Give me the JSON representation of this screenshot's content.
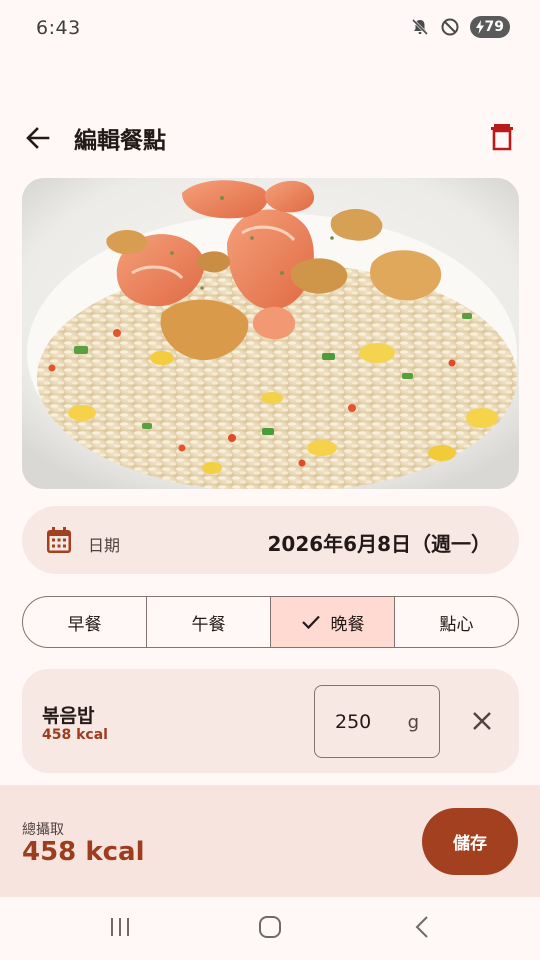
{
  "status_bar": {
    "time": "6:43",
    "battery_level": "79",
    "icons": [
      "mute-icon",
      "do-not-disturb-icon",
      "battery-icon"
    ]
  },
  "app_bar": {
    "title": "編輯餐點",
    "back_icon": "arrow-left-icon",
    "delete_icon": "trash-icon"
  },
  "photo": {
    "subject": "shrimp fried rice"
  },
  "date_field": {
    "label": "日期",
    "value": "2026年6月8日（週一）",
    "icon": "calendar-icon"
  },
  "meal_types": [
    {
      "label": "早餐",
      "selected": false
    },
    {
      "label": "午餐",
      "selected": false
    },
    {
      "label": "晚餐",
      "selected": true
    },
    {
      "label": "點心",
      "selected": false
    }
  ],
  "food_items": [
    {
      "name": "볶음밥",
      "kcal": "458 kcal",
      "grams": "250",
      "unit": "g"
    }
  ],
  "summary": {
    "label": "總攝取",
    "total_kcal": "458 kcal",
    "save_label": "儲存"
  },
  "colors": {
    "accent": "#A3401F",
    "accent_text": "#9C3D1E",
    "card_bg": "#F8E8E4",
    "selected_segment": "#FFDAD2",
    "background": "#FFF8F6",
    "delete_icon": "#BA1A1A"
  },
  "nav_bar": {
    "buttons": [
      "recents-icon",
      "home-icon",
      "back-nav-icon"
    ]
  }
}
